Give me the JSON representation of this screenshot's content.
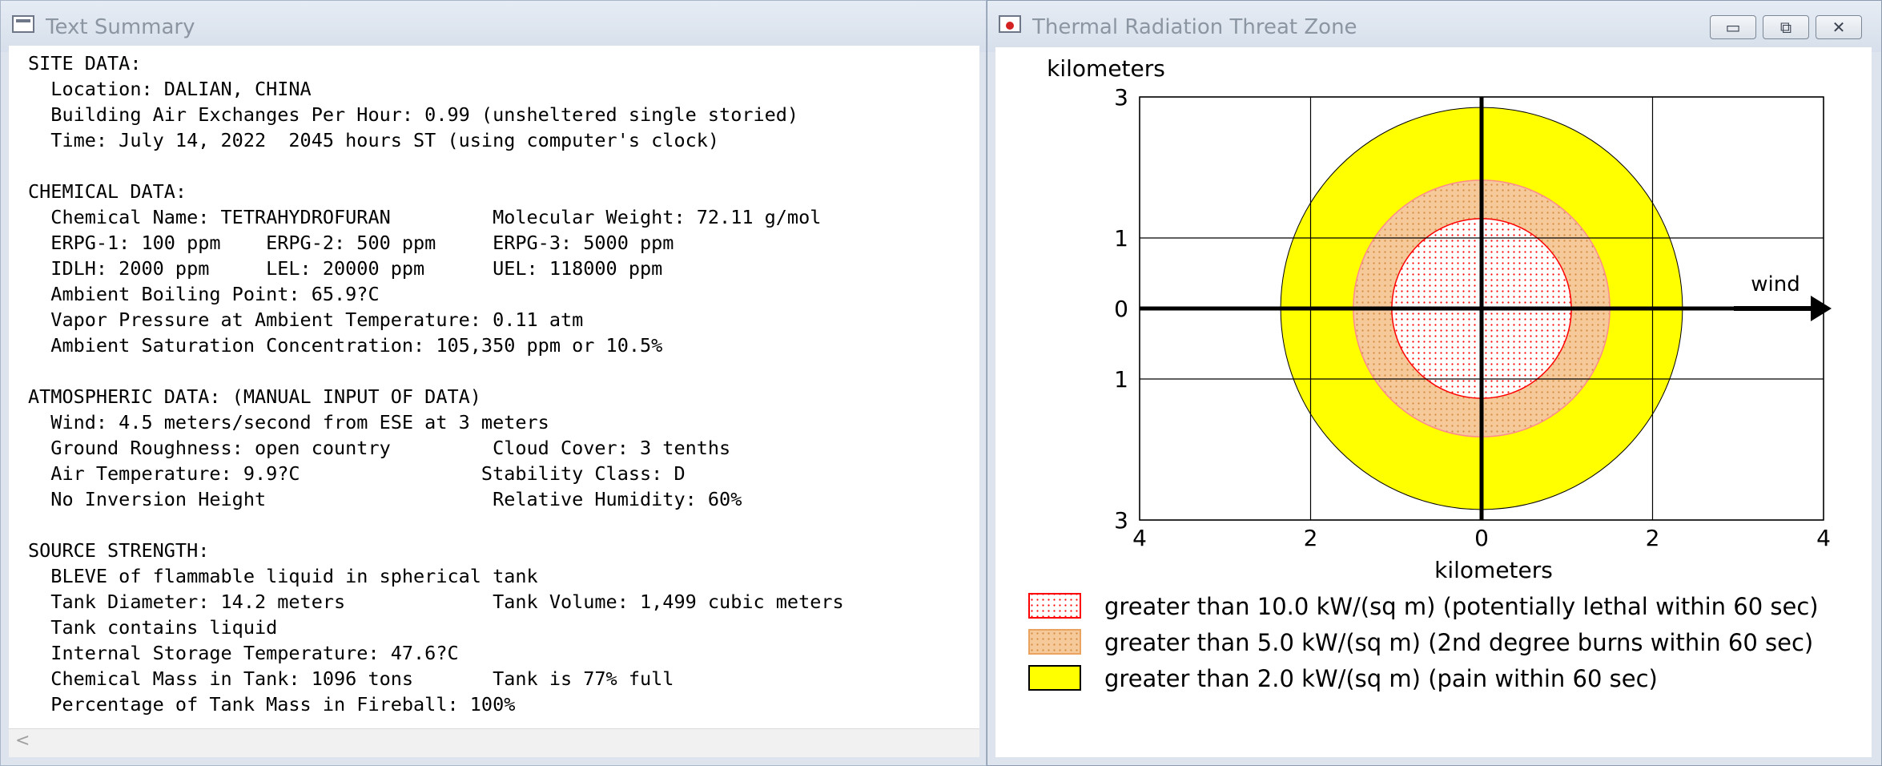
{
  "text_window": {
    "title": "Text Summary",
    "lines": [
      "SITE DATA:",
      "  Location: DALIAN, CHINA",
      "  Building Air Exchanges Per Hour: 0.99 (unsheltered single storied)",
      "  Time: July 14, 2022  2045 hours ST (using computer's clock)",
      "",
      "CHEMICAL DATA:",
      "  Chemical Name: TETRAHYDROFURAN         Molecular Weight: 72.11 g/mol",
      "  ERPG-1: 100 ppm    ERPG-2: 500 ppm     ERPG-3: 5000 ppm",
      "  IDLH: 2000 ppm     LEL: 20000 ppm      UEL: 118000 ppm",
      "  Ambient Boiling Point: 65.9?C",
      "  Vapor Pressure at Ambient Temperature: 0.11 atm",
      "  Ambient Saturation Concentration: 105,350 ppm or 10.5%",
      "",
      "ATMOSPHERIC DATA: (MANUAL INPUT OF DATA)",
      "  Wind: 4.5 meters/second from ESE at 3 meters",
      "  Ground Roughness: open country         Cloud Cover: 3 tenths",
      "  Air Temperature: 9.9?C                Stability Class: D",
      "  No Inversion Height                    Relative Humidity: 60%",
      "",
      "SOURCE STRENGTH:",
      "  BLEVE of flammable liquid in spherical tank",
      "  Tank Diameter: 14.2 meters             Tank Volume: 1,499 cubic meters",
      "  Tank contains liquid",
      "  Internal Storage Temperature: 47.6?C",
      "  Chemical Mass in Tank: 1096 tons       Tank is 77% full",
      "  Percentage of Tank Mass in Fireball: 100%"
    ],
    "scroll_left_arrow": "<"
  },
  "chart_window": {
    "title": "Thermal Radiation Threat Zone",
    "buttons": {
      "minimize": "▭",
      "restore": "⧉",
      "close": "✕"
    },
    "wind_label": "wind",
    "colors": {
      "zone_high": "#ff0000",
      "zone_mid": "#f5c99a",
      "zone_low": "#ffff00",
      "axis": "#000000",
      "grid": "#000000"
    }
  },
  "chart_data": {
    "type": "area",
    "title": "",
    "xlabel": "kilometers",
    "ylabel": "kilometers",
    "xlim": [
      -4,
      4
    ],
    "ylim": [
      -3,
      3
    ],
    "x_ticks": [
      {
        "value": -4,
        "label": "4"
      },
      {
        "value": -2,
        "label": "2"
      },
      {
        "value": 0,
        "label": "0"
      },
      {
        "value": 2,
        "label": "2"
      },
      {
        "value": 4,
        "label": "4"
      }
    ],
    "y_ticks": [
      {
        "value": 3,
        "label": "3"
      },
      {
        "value": 1,
        "label": "1"
      },
      {
        "value": 0,
        "label": "0"
      },
      {
        "value": -1,
        "label": "1"
      },
      {
        "value": -3,
        "label": "3"
      }
    ],
    "grid": true,
    "zones": [
      {
        "name": "greater than 2.0 kW/(sq m) (pain within 60 sec)",
        "radius_km": 2.35,
        "color": "#ffff00",
        "pattern": "solid"
      },
      {
        "name": "greater than 5.0 kW/(sq m) (2nd degree burns within 60 sec)",
        "radius_km": 1.5,
        "color": "#f5c99a",
        "pattern": "dotted"
      },
      {
        "name": "greater than 10.0 kW/(sq m) (potentially lethal within 60 sec)",
        "radius_km": 1.05,
        "color": "#ff0000",
        "pattern": "dotted"
      }
    ],
    "legend": [
      {
        "label": "greater than 10.0 kW/(sq m) (potentially lethal within 60 sec)",
        "swatch": "red-dots"
      },
      {
        "label": "greater than 5.0 kW/(sq m) (2nd degree burns within 60 sec)",
        "swatch": "orange-dots"
      },
      {
        "label": "greater than 2.0 kW/(sq m) (pain within 60 sec)",
        "swatch": "yellow"
      }
    ],
    "legend_placement": "bottom"
  }
}
